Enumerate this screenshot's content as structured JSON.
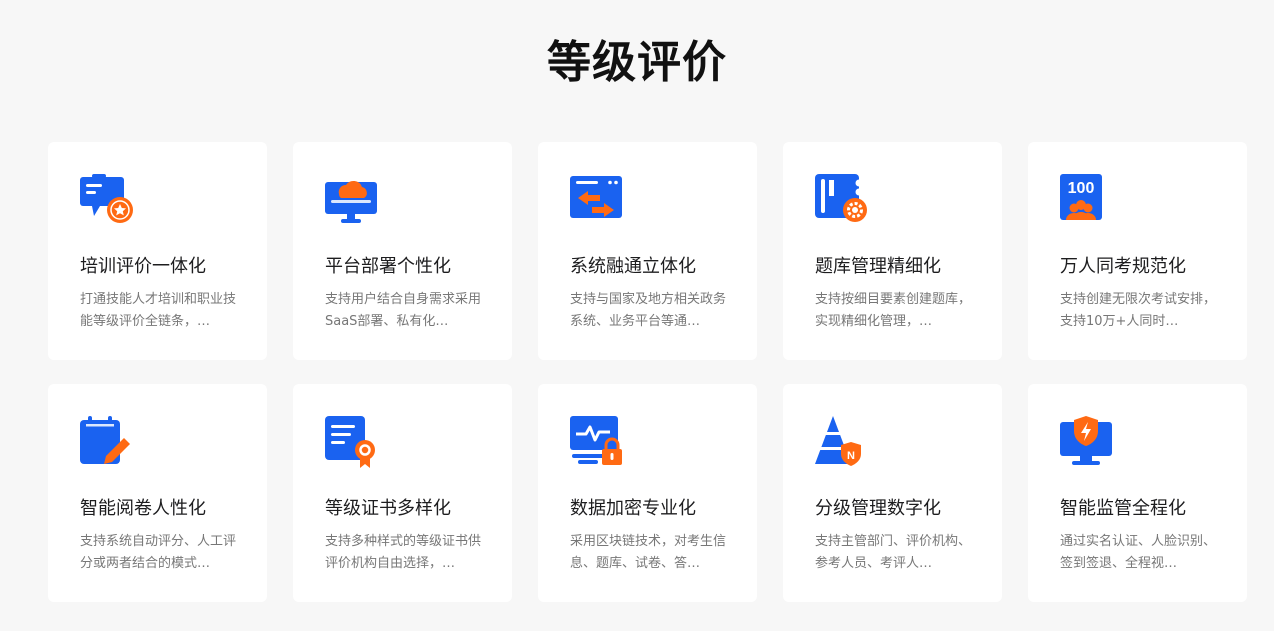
{
  "section_title": "等级评价",
  "colors": {
    "primary": "#1a62f0",
    "accent": "#ff6a13"
  },
  "cards": [
    {
      "icon": "chat-award-icon",
      "title": "培训评价一体化",
      "desc": "打通技能人才培训和职业技能等级评价全链条，…"
    },
    {
      "icon": "monitor-cloud-icon",
      "title": "平台部署个性化",
      "desc": "支持用户结合自身需求采用SaaS部署、私有化…"
    },
    {
      "icon": "window-transfer-icon",
      "title": "系统融通立体化",
      "desc": "支持与国家及地方相关政务系统、业务平台等通…"
    },
    {
      "icon": "book-gear-icon",
      "title": "题库管理精细化",
      "desc": "支持按细目要素创建题库，实现精细化管理，…"
    },
    {
      "icon": "score-people-icon",
      "title": "万人同考规范化",
      "desc": "支持创建无限次考试安排，支持10万+人同时…",
      "badge": "100"
    },
    {
      "icon": "notepad-pen-icon",
      "title": "智能阅卷人性化",
      "desc": "支持系统自动评分、人工评分或两者结合的模式…"
    },
    {
      "icon": "certificate-seal-icon",
      "title": "等级证书多样化",
      "desc": "支持多种样式的等级证书供评价机构自由选择，…"
    },
    {
      "icon": "monitor-lock-icon",
      "title": "数据加密专业化",
      "desc": "采用区块链技术，对考生信息、题库、试卷、答…"
    },
    {
      "icon": "pyramid-shield-icon",
      "title": "分级管理数字化",
      "desc": "支持主管部门、评价机构、参考人员、考评人…",
      "badge": "N"
    },
    {
      "icon": "monitor-shield-icon",
      "title": "智能监管全程化",
      "desc": "通过实名认证、人脸识别、签到签退、全程视…"
    }
  ]
}
